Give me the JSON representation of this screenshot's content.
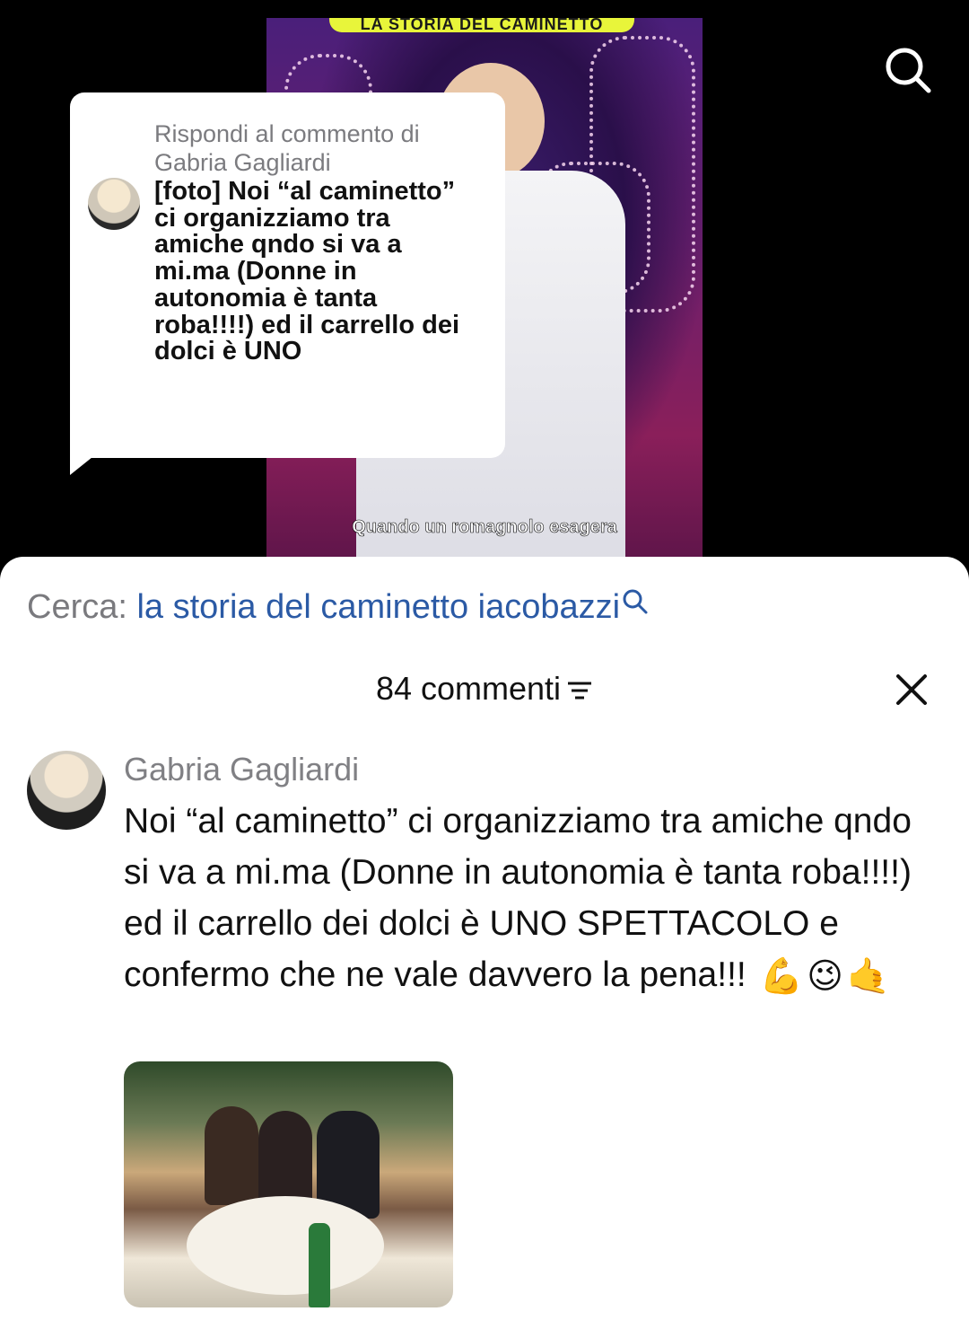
{
  "video": {
    "banner": "LA STORIA DEL CAMINETTO",
    "caption": "Quando un romagnolo esagera"
  },
  "reply": {
    "header": "Rispondi al commento di Gabria Gagliardi",
    "text": "[foto] Noi “al caminetto” ci organizziamo tra amiche qndo si va a mi.ma (Donne in autonomia è tanta roba!!!!) ed il carrello dei dolci è UNO"
  },
  "search": {
    "prefix": "Cerca: ",
    "term": "la storia del caminetto iacobazzi"
  },
  "comments_header": {
    "count_label": "84 commenti"
  },
  "comment": {
    "author": "Gabria Gagliardi",
    "text": "Noi “al caminetto” ci organizziamo tra amiche qndo si va a mi.ma (Donne in autonomia è tanta roba!!!!) ed il carrello dei dolci è UNO SPETTACOLO e confermo che ne vale davvero la pena!!!",
    "emojis": [
      "💪",
      "😉",
      "🤙"
    ]
  },
  "icons": [
    "search-icon",
    "filter-icon",
    "close-icon"
  ],
  "colors": {
    "search_term": "#2b5aa5",
    "banner": "#e8f53a"
  }
}
